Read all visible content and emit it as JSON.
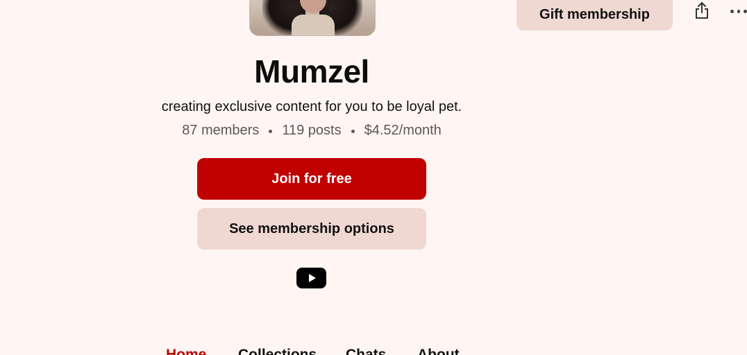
{
  "creator": {
    "name": "Mumzel",
    "tagline": "creating exclusive content for you to be loyal pet.",
    "stats": {
      "members": "87 members",
      "posts": "119 posts",
      "price": "$4.52/month"
    }
  },
  "header": {
    "gift_label": "Gift membership"
  },
  "actions": {
    "join_label": "Join for free",
    "options_label": "See membership options"
  },
  "social": {
    "links": [
      "youtube-icon"
    ]
  },
  "tabs": [
    {
      "label": "Home",
      "active": true
    },
    {
      "label": "Collections",
      "active": false
    },
    {
      "label": "Chats",
      "active": false
    },
    {
      "label": "About",
      "active": false
    }
  ],
  "colors": {
    "background": "#fff6f4",
    "accent": "#c10000",
    "secondary_button": "#f0d8d2"
  }
}
